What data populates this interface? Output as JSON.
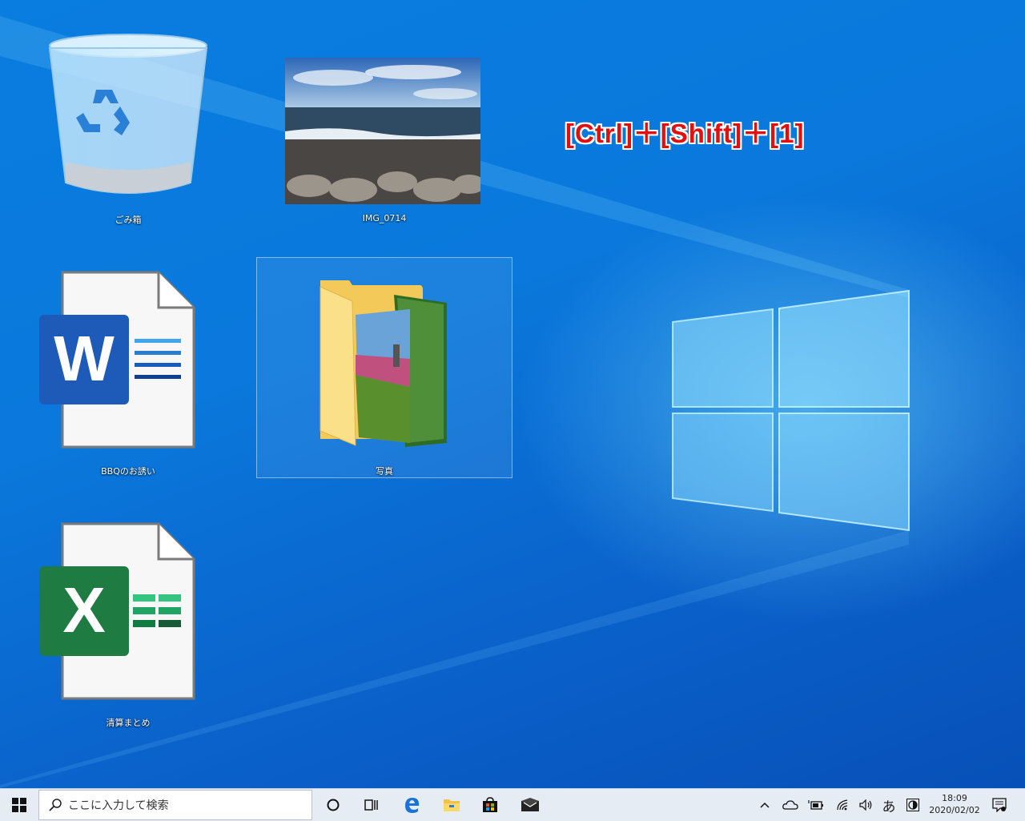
{
  "desktop": {
    "icons": [
      {
        "label": "ごみ箱"
      },
      {
        "label": "IMG_0714"
      },
      {
        "label": "BBQのお誘い"
      },
      {
        "label": "写真"
      },
      {
        "label": "清算まとめ"
      }
    ],
    "shortcut_annotation": "[Ctrl]＋[Shift]＋[1]",
    "word_letter": "W",
    "excel_letter": "X"
  },
  "taskbar": {
    "search_placeholder": "ここに入力して検索",
    "ime_label": "あ",
    "time": "18:09",
    "date": "2020/02/02"
  },
  "colors": {
    "accent_red": "#e01010",
    "word_blue": "#1e5bb8",
    "excel_green": "#1e7b42",
    "taskbar_bg": "#e6ecf3"
  }
}
